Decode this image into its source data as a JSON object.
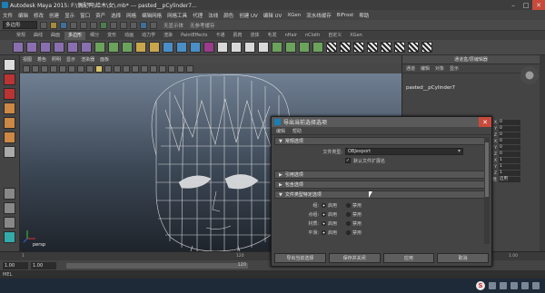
{
  "window": {
    "title": "Autodesk Maya 2015: F:\\偶配鸭\\给木\\女\\.mb* --- pasted__pCylinder7...",
    "min": "–",
    "max": "□",
    "close": "✕"
  },
  "menubar": [
    "文件",
    "编辑",
    "修改",
    "创建",
    "显示",
    "窗口",
    "资产",
    "选择",
    "网格",
    "编辑网格",
    "网格工具",
    "代理",
    "法线",
    "颜色",
    "创建 UV",
    "编辑 UV",
    "XGen",
    "流水线缓存",
    "BiFrost",
    "帮助"
  ],
  "statusline": {
    "mode": "多边形",
    "text": "无显示体",
    "status_text": "无参考缓存"
  },
  "shelf_tabs": [
    "常规",
    "曲线",
    "曲面",
    "多边形",
    "细分",
    "变形",
    "动画",
    "动力学",
    "渲染",
    "PaintEffects",
    "卡通",
    "肌肉",
    "流体",
    "毛发",
    "nHair",
    "nCloth",
    "自定义",
    "XGen"
  ],
  "shelf_active_tab": "多边形",
  "viewport": {
    "menu": [
      "视图",
      "着色",
      "照明",
      "显示",
      "渲染器",
      "面板"
    ],
    "camera_label": "persp"
  },
  "channel_box": {
    "header": "通道盒/层编辑器",
    "tabs": [
      "通道",
      "编辑",
      "对象",
      "显示"
    ],
    "object": "pasted__pCylinder7",
    "attributes": [
      {
        "label": "平移 X",
        "value": "0"
      },
      {
        "label": "平移 Y",
        "value": "0"
      },
      {
        "label": "平移 Z",
        "value": "0"
      },
      {
        "label": "旋转 X",
        "value": "0"
      },
      {
        "label": "旋转 Y",
        "value": "0"
      },
      {
        "label": "旋转 Z",
        "value": "0"
      },
      {
        "label": "缩放 X",
        "value": "1"
      },
      {
        "label": "缩放 Y",
        "value": "1"
      },
      {
        "label": "缩放 Z",
        "value": "1"
      },
      {
        "label": "可见性",
        "value": "启用"
      }
    ]
  },
  "timeline": {
    "ticks": [
      "1",
      "120",
      "1.00"
    ],
    "start": "1.00",
    "end": "1.00",
    "range_end": "120"
  },
  "range": {
    "start_field": "1.00",
    "current_field": "1.00",
    "slider_end": "120"
  },
  "command_line": {
    "label": "MEL"
  },
  "taskbar": {
    "ime_label": "S"
  },
  "dialog": {
    "title": "导出当前选择选项",
    "close": "✕",
    "menu": [
      "编辑",
      "帮助"
    ],
    "sections": {
      "general": "常规选项",
      "references": "引用选项",
      "include": "包含选项",
      "file_type": "文件类型特定选项"
    },
    "file_type_label": "文件类型:",
    "file_type_value": "OBJexport",
    "default_ext_label": "默认文件扩展名",
    "default_ext_checked": "✓",
    "options": [
      {
        "label": "组:",
        "on": "启用",
        "off": "禁用"
      },
      {
        "label": "点组:",
        "on": "启用",
        "off": "禁用"
      },
      {
        "label": "材质:",
        "on": "启用",
        "off": "禁用"
      },
      {
        "label": "平滑:",
        "on": "启用",
        "off": "禁用"
      }
    ],
    "buttons": [
      "导出当前选择",
      "保存并关闭",
      "应用",
      "取消"
    ]
  }
}
